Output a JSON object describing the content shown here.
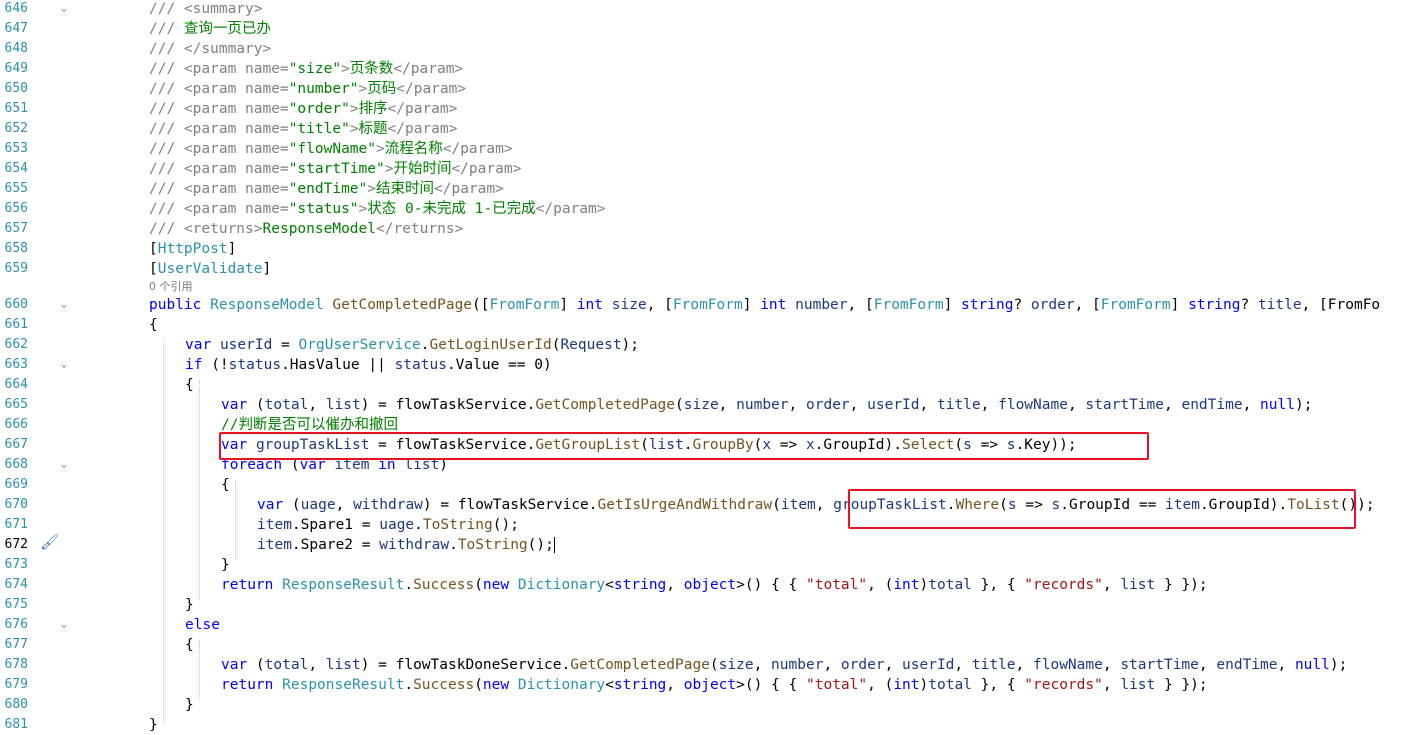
{
  "editor": {
    "lens_text": "0 个引用",
    "lines": [
      {
        "no": "646",
        "code": "/// <summary>"
      },
      {
        "no": "647",
        "code": "/// 查询一页已办"
      },
      {
        "no": "648",
        "code": "/// </summary>"
      },
      {
        "no": "649",
        "code": "/// <param name=\"size\">页条数</param>"
      },
      {
        "no": "650",
        "code": "/// <param name=\"number\">页码</param>"
      },
      {
        "no": "651",
        "code": "/// <param name=\"order\">排序</param>"
      },
      {
        "no": "652",
        "code": "/// <param name=\"title\">标题</param>"
      },
      {
        "no": "653",
        "code": "/// <param name=\"flowName\">流程名称</param>"
      },
      {
        "no": "654",
        "code": "/// <param name=\"startTime\">开始时间</param>"
      },
      {
        "no": "655",
        "code": "/// <param name=\"endTime\">结束时间</param>"
      },
      {
        "no": "656",
        "code": "/// <param name=\"status\">状态 0-未完成 1-已完成</param>"
      },
      {
        "no": "657",
        "code": "/// <returns>ResponseModel</returns>"
      },
      {
        "no": "658",
        "code": "[HttpPost]"
      },
      {
        "no": "659",
        "code": "[UserValidate]"
      },
      {
        "no": "660",
        "code": "public ResponseModel GetCompletedPage([FromForm] int size, [FromForm] int number, [FromForm] string? order, [FromForm] string? title, [FromFo"
      },
      {
        "no": "661",
        "code": "{"
      },
      {
        "no": "662",
        "code": "var userId = OrgUserService.GetLoginUserId(Request);"
      },
      {
        "no": "663",
        "code": "if (!status.HasValue || status.Value == 0)"
      },
      {
        "no": "664",
        "code": "{"
      },
      {
        "no": "665",
        "code": "var (total, list) = flowTaskService.GetCompletedPage(size, number, order, userId, title, flowName, startTime, endTime, null);"
      },
      {
        "no": "666",
        "code": "//判断是否可以催办和撤回"
      },
      {
        "no": "667",
        "code": "var groupTaskList = flowTaskService.GetGroupList(list.GroupBy(x => x.GroupId).Select(s => s.Key));"
      },
      {
        "no": "668",
        "code": "foreach (var item in list)"
      },
      {
        "no": "669",
        "code": "{"
      },
      {
        "no": "670",
        "code": "var (uage, withdraw) = flowTaskService.GetIsUrgeAndWithdraw(item, groupTaskList.Where(s => s.GroupId == item.GroupId).ToList());"
      },
      {
        "no": "671",
        "code": "item.Spare1 = uage.ToString();"
      },
      {
        "no": "672",
        "code": "item.Spare2 = withdraw.ToString();"
      },
      {
        "no": "673",
        "code": "}"
      },
      {
        "no": "674",
        "code": "return ResponseResult.Success(new Dictionary<string, object>() { { \"total\", (int)total }, { \"records\", list } });"
      },
      {
        "no": "675",
        "code": "}"
      },
      {
        "no": "676",
        "code": "else"
      },
      {
        "no": "677",
        "code": "{"
      },
      {
        "no": "678",
        "code": "var (total, list) = flowTaskDoneService.GetCompletedPage(size, number, order, userId, title, flowName, startTime, endTime, null);"
      },
      {
        "no": "679",
        "code": "return ResponseResult.Success(new Dictionary<string, object>() { { \"total\", (int)total }, { \"records\", list } });"
      },
      {
        "no": "680",
        "code": "}"
      },
      {
        "no": "681",
        "code": "}"
      }
    ]
  },
  "colors": {
    "comment": "#008000",
    "keyword": "#0000ff",
    "type": "#2b91af",
    "method": "#74531f",
    "string": "#a31515",
    "highlight_box": "#e81123",
    "line_number": "#2b91af"
  }
}
